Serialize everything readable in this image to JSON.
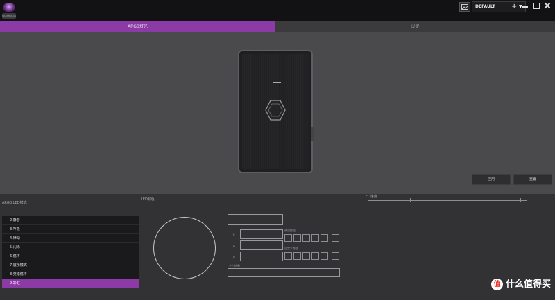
{
  "app": {
    "logo_text": "MASTERPLUS"
  },
  "header": {
    "profile_name": "DEFAULT",
    "add_label": "+",
    "chevron": "⌄"
  },
  "tabs": [
    {
      "label": "ARGB灯光"
    },
    {
      "label": "设定"
    }
  ],
  "preview": {
    "apply_label": "应用",
    "reset_label": "重置"
  },
  "lower": {
    "argb_mode_label": "ARGB LED模式",
    "led_color_label": "LED颜色",
    "led_speed_label": "LED速度",
    "modes": [
      {
        "label": "2.静音"
      },
      {
        "label": "3.呼吸"
      },
      {
        "label": "4.律动"
      },
      {
        "label": "5.闪烁"
      },
      {
        "label": "6.循环"
      },
      {
        "label": "7.展示模式"
      },
      {
        "label": "8.交错循环"
      },
      {
        "label": "9.彩虹"
      }
    ],
    "active_mode_index": 7,
    "rgb_labels": [
      "R",
      "G",
      "B"
    ],
    "custom_color_label": "预设颜色",
    "custom_color_label_2": "自定义颜色",
    "hex_label": "十六进制"
  },
  "watermark": {
    "text": "值 什么值得买",
    "icon": "值"
  },
  "colors": {
    "accent": "#8c3aa5"
  }
}
